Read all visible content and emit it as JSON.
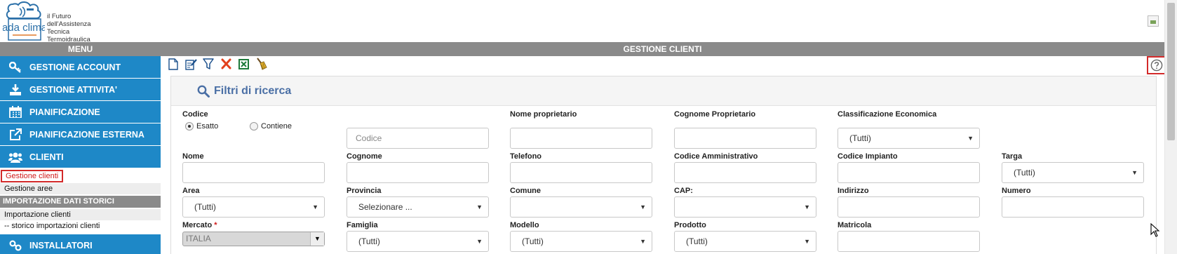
{
  "header": {
    "logo_text": "ada clima",
    "tagline": [
      "il Futuro",
      "dell'Assistenza",
      "Tecnica",
      "Termoidraulica"
    ],
    "menu_title": "MENU",
    "page_title": "GESTIONE CLIENTI"
  },
  "sidebar": {
    "items_top": [
      {
        "label": "GESTIONE ACCOUNT",
        "icon": "key-icon"
      },
      {
        "label": "GESTIONE ATTIVITA'",
        "icon": "download-icon"
      },
      {
        "label": "PIANIFICAZIONE",
        "icon": "calendar-icon"
      },
      {
        "label": "PIANIFICAZIONE ESTERNA",
        "icon": "external-link-icon"
      },
      {
        "label": "CLIENTI",
        "icon": "users-icon"
      }
    ],
    "clienti_sub": [
      "Gestione clienti",
      "Gestione aree"
    ],
    "section_import": "IMPORTAZIONE DATI STORICI",
    "import_sub": [
      "Importazione clienti",
      "-- storico importazioni clienti"
    ],
    "installatori": {
      "label": "INSTALLATORI",
      "icon": "link-icon"
    }
  },
  "toolbar": {
    "icons": [
      "new-document-icon",
      "edit-icon",
      "filter-icon",
      "clear-icon",
      "excel-export-icon",
      "broom-icon"
    ]
  },
  "panel": {
    "title": "Filtri di ricerca"
  },
  "form": {
    "codice_label": "Codice",
    "radio_esatto": "Esatto",
    "radio_contiene": "Contiene",
    "codice_placeholder": "Codice",
    "nome_proprietario": "Nome proprietario",
    "cognome_proprietario": "Cognome Proprietario",
    "classificazione": "Classificazione Economica",
    "classificazione_value": "(Tutti)",
    "nome": "Nome",
    "cognome": "Cognome",
    "telefono": "Telefono",
    "codice_amministrativo": "Codice Amministrativo",
    "codice_impianto": "Codice Impianto",
    "targa": "Targa",
    "targa_value": "(Tutti)",
    "area": "Area",
    "area_value": "(Tutti)",
    "provincia": "Provincia",
    "provincia_value": "Selezionare ...",
    "comune": "Comune",
    "comune_value": "",
    "cap": "CAP:",
    "cap_value": "",
    "indirizzo": "Indirizzo",
    "numero": "Numero",
    "mercato": "Mercato",
    "mercato_required": "*",
    "mercato_value": "ITALIA",
    "famiglia": "Famiglia",
    "famiglia_value": "(Tutti)",
    "modello": "Modello",
    "modello_value": "(Tutti)",
    "prodotto": "Prodotto",
    "prodotto_value": "(Tutti)",
    "matricola": "Matricola"
  },
  "colors": {
    "nav_blue": "#1e88c7",
    "bar_grey": "#8a8a8a",
    "title_blue": "#4a6fa5",
    "highlight_red": "#d32a2a"
  }
}
